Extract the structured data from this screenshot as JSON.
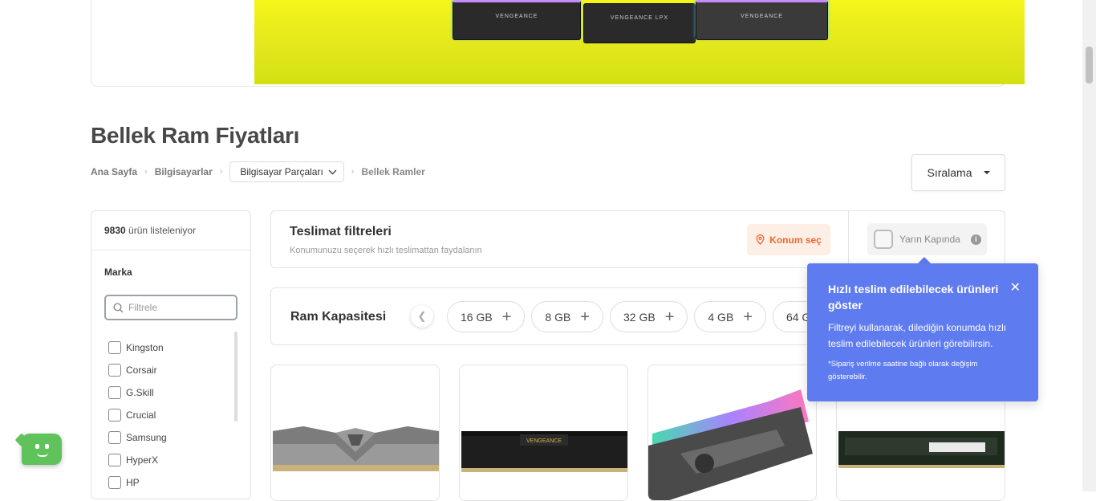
{
  "banner": {
    "sticks": [
      "VENGEANCE",
      "VENGEANCE LPX",
      "VENGEANCE"
    ]
  },
  "page_title": "Bellek Ram Fiyatları",
  "breadcrumb": {
    "home": "Ana Sayfa",
    "computers": "Bilgisayarlar",
    "parts": "Bilgisayar Parçaları",
    "current": "Bellek Ramler"
  },
  "sort": {
    "label": "Sıralama"
  },
  "sidebar": {
    "count_number": "9830",
    "count_text": "ürün listeleniyor",
    "brand_title": "Marka",
    "filter_placeholder": "Filtrele",
    "brands": [
      "Kingston",
      "Corsair",
      "G.Skill",
      "Crucial",
      "Samsung",
      "HyperX",
      "HP"
    ]
  },
  "delivery": {
    "title": "Teslimat filtreleri",
    "subtitle": "Konumunuzu seçerek hızlı teslimattan faydalanın",
    "location_button": "Konum seç",
    "tomorrow_label": "Yarın Kapında"
  },
  "capacity": {
    "title": "Ram Kapasitesi",
    "chips": [
      "16 GB",
      "8 GB",
      "32 GB",
      "4 GB",
      "64 GB"
    ]
  },
  "tooltip": {
    "title": "Hızlı teslim edilebilecek ürünleri göster",
    "body": "Filtreyi kullanarak, dilediğin konumda hızlı teslim edilebilecek ürünleri görebilirsin.",
    "note": "*Sipariş verilme saatine bağlı olarak değişim gösterebilir."
  },
  "colors": {
    "tooltip_bg": "#5f7bf0",
    "location_accent": "#f2672e",
    "chat_green": "#60c25a"
  }
}
